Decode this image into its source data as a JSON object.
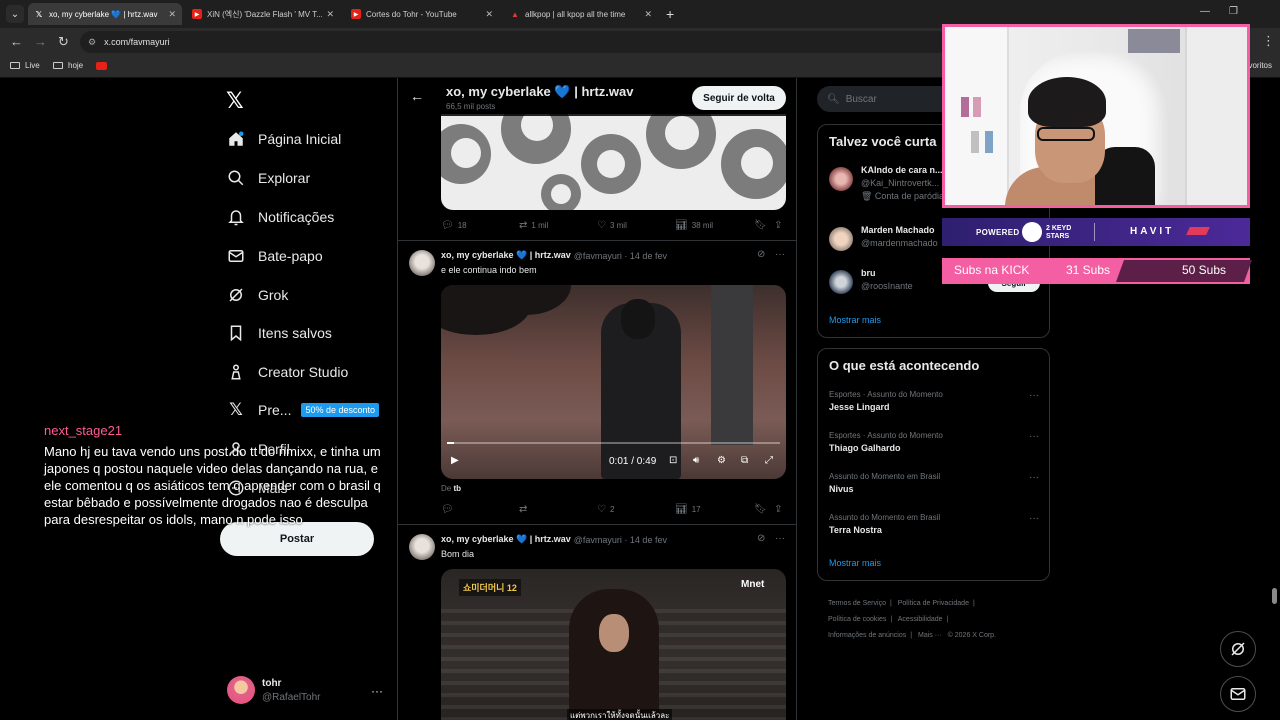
{
  "browser": {
    "tabs": [
      {
        "title": "xo, my cyberlake 💙 | hrtz.wav",
        "active": true,
        "favicon": "x-icon"
      },
      {
        "title": "XiN (엑신) 'Dazzle Flash ' MV T...",
        "active": false,
        "favicon": "youtube-icon"
      },
      {
        "title": "Cortes do Tohr - YouTube",
        "active": false,
        "favicon": "youtube-icon"
      },
      {
        "title": "allkpop | all kpop all the time",
        "active": false,
        "favicon": "allkpop-icon"
      }
    ],
    "url": "x.com/favmayuri",
    "bookmarks": [
      "Live",
      "hoje"
    ],
    "favoritos": "voritos"
  },
  "nav": {
    "items": [
      {
        "label": "Página Inicial",
        "icon": "home-icon"
      },
      {
        "label": "Explorar",
        "icon": "search-icon"
      },
      {
        "label": "Notificações",
        "icon": "bell-icon"
      },
      {
        "label": "Bate-papo",
        "icon": "mail-icon"
      },
      {
        "label": "Grok",
        "icon": "grok-icon"
      },
      {
        "label": "Itens salvos",
        "icon": "bookmark-icon"
      },
      {
        "label": "Creator Studio",
        "icon": "creator-icon"
      },
      {
        "label": "Pre...",
        "icon": "x-premium-icon",
        "badge": "50% de desconto"
      },
      {
        "label": "Perfil",
        "icon": "profile-icon"
      },
      {
        "label": "Mais",
        "icon": "more-icon"
      }
    ],
    "post_button": "Postar",
    "account": {
      "name": "tohr",
      "handle": "@RafaelTohr"
    }
  },
  "profile_header": {
    "name": "xo, my cyberlake 💙 | hrtz.wav",
    "posts_count": "66,5 mil posts",
    "follow_back": "Seguir de volta"
  },
  "posts": [
    {
      "stats": {
        "replies": "18",
        "reposts": "1 mil",
        "likes": "3 mil",
        "views": "38 mil"
      }
    },
    {
      "name": "xo, my cyberlake 💙 | hrtz.wav",
      "handle": "@favmayuri · 14 de fev",
      "text": "e ele continua indo bem",
      "video_time": "0:01 / 0:49",
      "video_progress": 0.02,
      "from_label": "De",
      "from_user": "tb",
      "stats": {
        "replies": "",
        "reposts": "",
        "likes": "2",
        "views": "17"
      }
    },
    {
      "name": "xo, my cyberlake 💙 | hrtz.wav",
      "handle": "@favmayuri · 14 de fev",
      "text": "Bom dia",
      "image_caption": "แต่พวกเราให้ทั้งจดนั้นแล้วละ",
      "image_logo": "쇼미더머니 12",
      "image_brand": "Mnet"
    }
  ],
  "sidebar": {
    "search_placeholder": "Buscar",
    "who_to_follow": {
      "title": "Talvez você curta",
      "people": [
        {
          "name": "KAIndo de cara n...",
          "handle": "@Kai_Nintrovertk...",
          "extra": "🗑 Conta de paródia"
        },
        {
          "name": "Marden Machado",
          "handle": "@mardenmachado"
        },
        {
          "name": "bru",
          "handle": "@roosInante"
        }
      ],
      "follow_label": "Seguir",
      "show_more": "Mostrar mais"
    },
    "trends": {
      "title": "O que está acontecendo",
      "items": [
        {
          "context": "Esportes · Assunto do Momento",
          "name": "Jesse Lingard"
        },
        {
          "context": "Esportes · Assunto do Momento",
          "name": "Thiago Galhardo"
        },
        {
          "context": "Assunto do Momento em Brasil",
          "name": "Nivus"
        },
        {
          "context": "Assunto do Momento em Brasil",
          "name": "Terra Nostra"
        }
      ],
      "show_more": "Mostrar mais"
    },
    "footer": [
      "Termos de Serviço",
      "|",
      "Política de Privacidade",
      "|",
      "Política de cookies",
      "|",
      "Acessibilidade",
      "|",
      "Informações de anúncios",
      "|",
      "Mais ···",
      "© 2026 X Corp."
    ]
  },
  "overlay": {
    "sponsor": {
      "powered_by": "POWERED BY",
      "brand1_line1": "2 KEYD",
      "brand1_line2": "STARS",
      "brand2": "HAVIT"
    },
    "subs": {
      "label": "Subs na KICK",
      "current": "31 Subs",
      "goal": "50 Subs"
    },
    "chat": {
      "username": "next_stage21",
      "message": "Mano hj eu tava vendo uns post do tt do nmixx, e tinha um japones q postou naquele video delas dançando na rua, e ele comentou q os asiáticos tem q aprender com o brasil q estar bêbado e possívelmente drogados nao é desculpa para desrespeitar os idols, mano n pode isso"
    }
  },
  "colors": {
    "accent": "#1d9bf0",
    "overlay_pink": "#f45ea2",
    "chat_name": "#ff5d8f"
  }
}
